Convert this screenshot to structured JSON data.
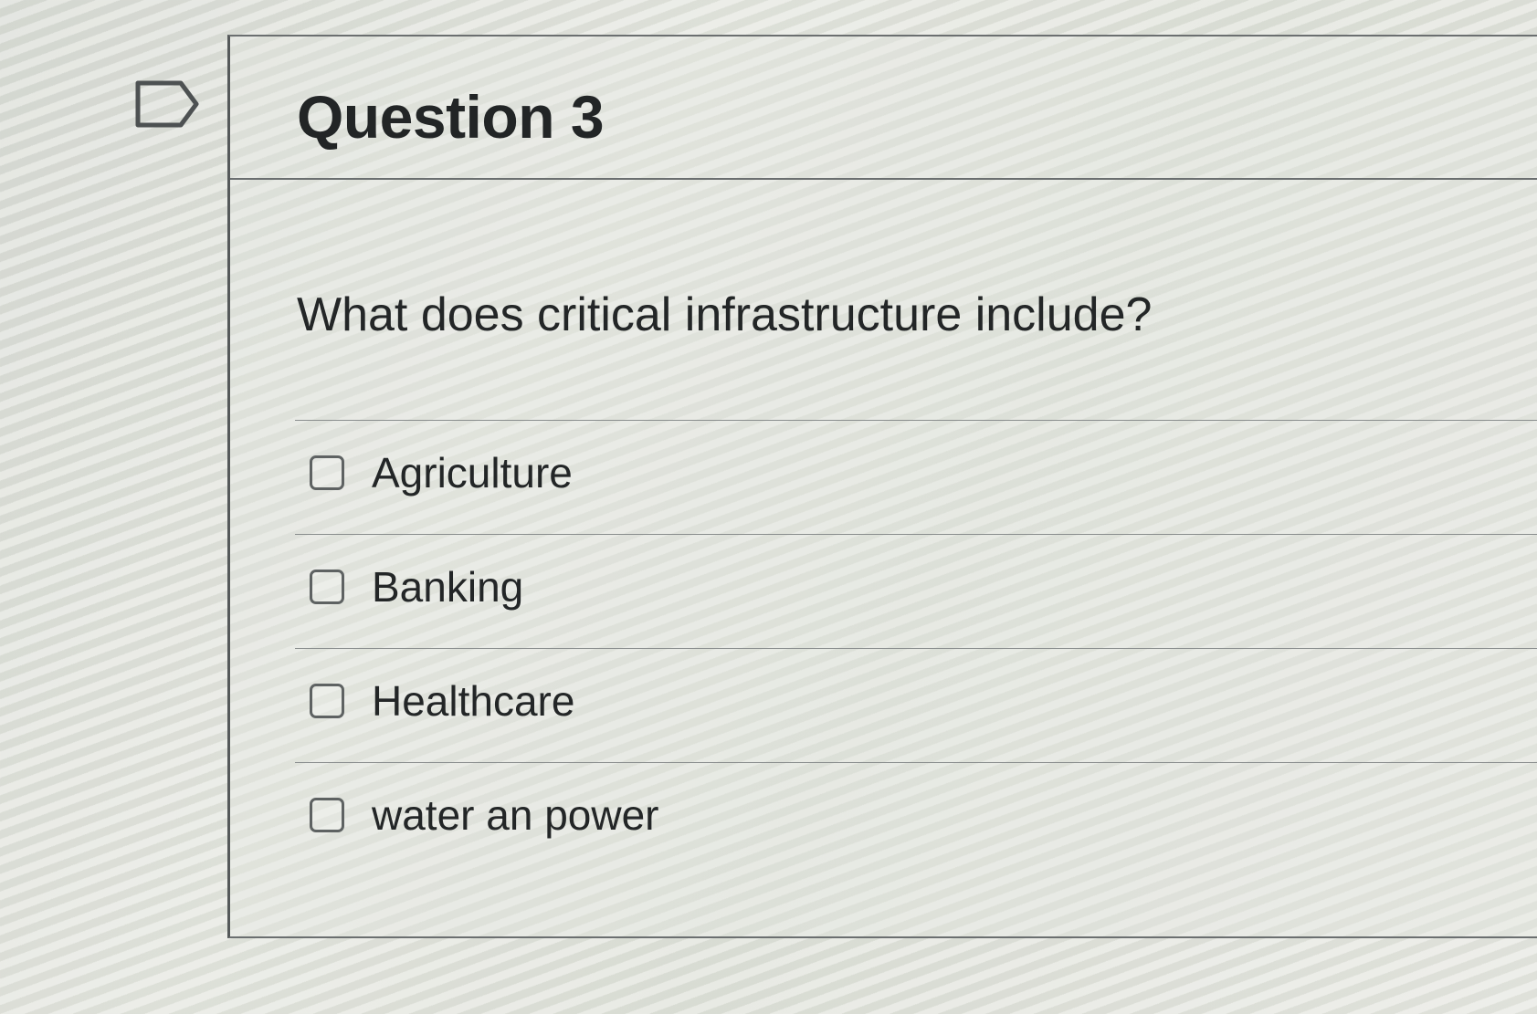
{
  "question": {
    "title": "Question 3",
    "prompt": "What does critical infrastructure include?",
    "flag_icon": "flag-outline-icon",
    "options": [
      {
        "label": "Agriculture",
        "checked": false
      },
      {
        "label": "Banking",
        "checked": false
      },
      {
        "label": "Healthcare",
        "checked": false
      },
      {
        "label": "water an power",
        "checked": false
      }
    ]
  },
  "colors": {
    "text": "#232627",
    "border": "#6b6f70",
    "checkbox_border": "#5e6262"
  }
}
